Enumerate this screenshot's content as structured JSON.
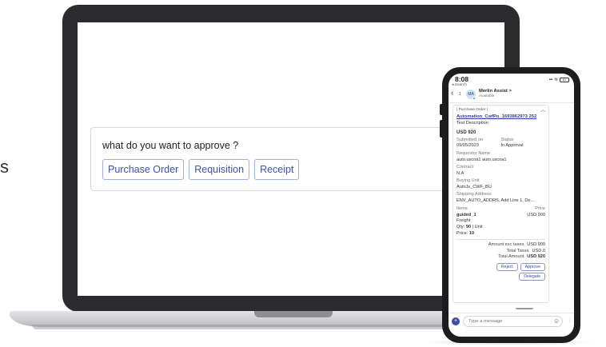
{
  "left_fragment": "s",
  "laptop": {
    "question": "what do you want to approve ?",
    "buttons": [
      "Purchase Order",
      "Requisition",
      "Receipt"
    ]
  },
  "phone": {
    "status_bar": {
      "time": "8:08",
      "back_label": "◂ Search",
      "battery": "61"
    },
    "chat_header": {
      "count": "1",
      "avatar_initials": "MA",
      "name": "Merlin Assist >",
      "status": "Available"
    },
    "message": {
      "header": "| Purchase Order |",
      "po_link": "Automation_CwfPo_1693862973 252",
      "description": "Test Description",
      "amount": "USD 920",
      "submitted_on_label": "Submitted on",
      "submitted_on": "09/05/2023",
      "status_label": "Status",
      "status": "In Approval",
      "requestor_label": "Requestor Name",
      "requestor": "auto.uscoa1 auto.uscoa1",
      "contract_label": "Contract",
      "contract": "N.A",
      "buying_unit_label": "Buying Unit",
      "buying_unit": "AutoJs_CWF_BU",
      "shipping_label": "Shipping Address",
      "shipping": "ENV_AUTO_ADDRS, Add Line 1, De...",
      "items_label": "Items",
      "price_label": "Price",
      "item_name": "guided_1",
      "item_price": "USD 900",
      "item_type": "Freight",
      "qty_label": "Qty:",
      "qty_value": "90",
      "qty_unit": "| Unit",
      "price_line_label": "Price:",
      "price_line_value": "10",
      "totals": [
        {
          "label": "Amount exc taxes",
          "value": "USD 900"
        },
        {
          "label": "Total Taxes",
          "value": "USD 0"
        },
        {
          "label": "Total Amount",
          "value": "USD 920"
        }
      ],
      "buttons": {
        "reject": "Reject",
        "approve": "Approve",
        "delegate": "Delegate"
      }
    },
    "composer": {
      "placeholder": "Type a message",
      "plus": "+",
      "emoji": "☺",
      "more": "⋮"
    }
  }
}
